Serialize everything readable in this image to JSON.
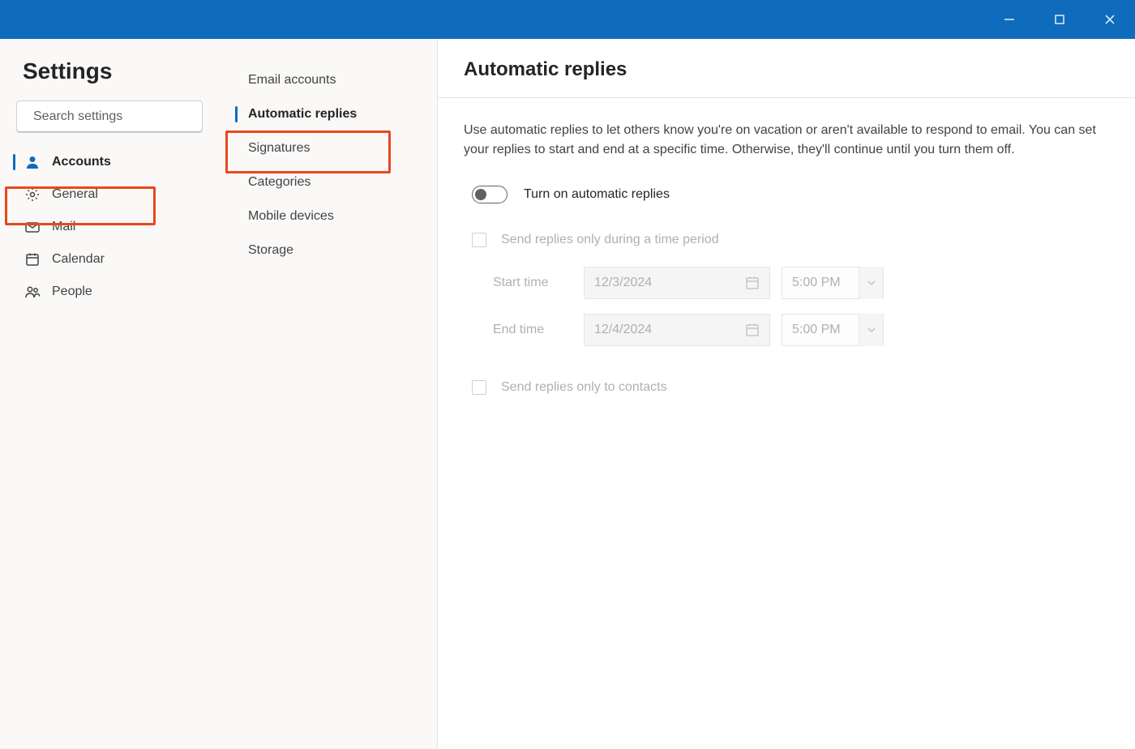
{
  "titlebar": {
    "minimize": "Minimize",
    "maximize": "Maximize",
    "close": "Close"
  },
  "sidebar": {
    "title": "Settings",
    "search_placeholder": "Search settings",
    "items": [
      {
        "id": "accounts",
        "label": "Accounts",
        "icon": "person",
        "selected": true
      },
      {
        "id": "general",
        "label": "General",
        "icon": "gear",
        "selected": false
      },
      {
        "id": "mail",
        "label": "Mail",
        "icon": "mail",
        "selected": false
      },
      {
        "id": "calendar",
        "label": "Calendar",
        "icon": "calendar",
        "selected": false
      },
      {
        "id": "people",
        "label": "People",
        "icon": "people",
        "selected": false
      }
    ]
  },
  "subnav": {
    "items": [
      {
        "id": "email-accounts",
        "label": "Email accounts",
        "selected": false
      },
      {
        "id": "automatic-replies",
        "label": "Automatic replies",
        "selected": true
      },
      {
        "id": "signatures",
        "label": "Signatures",
        "selected": false
      },
      {
        "id": "categories",
        "label": "Categories",
        "selected": false
      },
      {
        "id": "mobile-devices",
        "label": "Mobile devices",
        "selected": false
      },
      {
        "id": "storage",
        "label": "Storage",
        "selected": false
      }
    ]
  },
  "content": {
    "title": "Automatic replies",
    "description": "Use automatic replies to let others know you're on vacation or aren't available to respond to email. You can set your replies to start and end at a specific time. Otherwise, they'll continue until you turn them off.",
    "toggle_label": "Turn on automatic replies",
    "toggle_on": false,
    "time_period_label": "Send replies only during a time period",
    "time_period_checked": false,
    "start_label": "Start time",
    "start_date": "12/3/2024",
    "start_time": "5:00 PM",
    "end_label": "End time",
    "end_date": "12/4/2024",
    "end_time": "5:00 PM",
    "contacts_label": "Send replies only to contacts",
    "contacts_checked": false
  },
  "highlights": {
    "accounts": true,
    "automatic_replies": true
  }
}
